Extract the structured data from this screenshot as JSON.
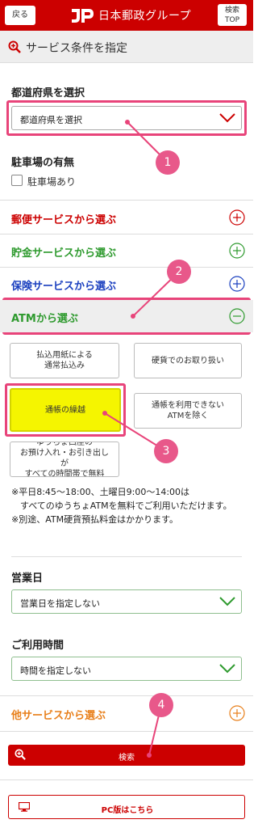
{
  "header": {
    "back_label": "戻る",
    "logo_text": "日本郵政グループ",
    "top_label_1": "検索",
    "top_label_2": "TOP"
  },
  "titlebar": {
    "title": "サービス条件を指定"
  },
  "prefecture": {
    "label": "都道府県を選択",
    "value": "都道府県を選択"
  },
  "parking": {
    "label": "駐車場の有無",
    "checkbox_label": "駐車場あり",
    "checked": false
  },
  "accordions": [
    {
      "label": "郵便サービスから選ぶ",
      "color": "#cc0000",
      "state": "closed"
    },
    {
      "label": "貯金サービスから選ぶ",
      "color": "#2e9a2e",
      "state": "closed"
    },
    {
      "label": "保険サービスから選ぶ",
      "color": "#1a3fbf",
      "state": "closed"
    },
    {
      "label": "ATMから選ぶ",
      "color": "#2e9a2e",
      "state": "open"
    }
  ],
  "atm_options": [
    {
      "label_1": "払込用紙による",
      "label_2": "通常払込み",
      "selected": false
    },
    {
      "label_1": "硬貨でのお取り扱い",
      "label_2": "",
      "selected": false
    },
    {
      "label_1": "通帳の繰越",
      "label_2": "",
      "selected": true
    },
    {
      "label_1": "通帳を利用できない",
      "label_2": "ATMを除く",
      "selected": false
    },
    {
      "label_1": "ゆうちょ口座の",
      "label_2": "お預け入れ・お引き出し",
      "label_3": "が",
      "label_4": "すべての時間帯で無料",
      "selected": false
    }
  ],
  "notes": {
    "line1": "※平日8:45～18:00、土曜日9:00～14:00は",
    "line2": "　すべてのゆうちょATMを無料でご利用いただけます。",
    "line3": "※別途、ATM硬貨預払料金はかかります。"
  },
  "business_day": {
    "label": "営業日",
    "value": "営業日を指定しない"
  },
  "hours": {
    "label": "ご利用時間",
    "value": "時間を指定しない"
  },
  "other_services": {
    "label": "他サービスから選ぶ",
    "color": "#e87f1a"
  },
  "search": {
    "label": "検索"
  },
  "pc_version": {
    "label": "PC版はこちら"
  },
  "callouts": [
    "1",
    "2",
    "3",
    "4"
  ],
  "colors": {
    "brand_red": "#cc0000",
    "accent_pink": "#e8447a",
    "select_green": "#2e9a2e",
    "highlight_yellow": "#f5f500"
  },
  "icons": [
    "magnifier-plus-icon",
    "chevron-down-icon",
    "plus-circle-icon",
    "minus-circle-icon",
    "monitor-icon"
  ]
}
